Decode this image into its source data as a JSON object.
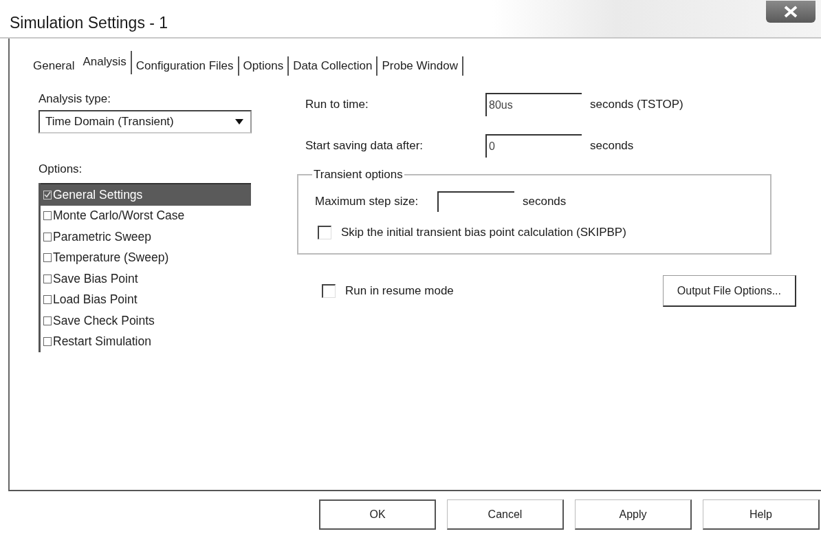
{
  "window": {
    "title": "Simulation Settings - 1"
  },
  "tabs": [
    {
      "label": "General",
      "selected": false
    },
    {
      "label": "Analysis",
      "selected": true
    },
    {
      "label": "Configuration Files",
      "selected": false
    },
    {
      "label": "Options",
      "selected": false
    },
    {
      "label": "Data Collection",
      "selected": false
    },
    {
      "label": "Probe Window",
      "selected": false
    }
  ],
  "analysis_type": {
    "label": "Analysis type:",
    "value": "Time Domain (Transient)"
  },
  "options": {
    "label": "Options:",
    "items": [
      {
        "label": "General Settings",
        "checked": true,
        "selected": true
      },
      {
        "label": "Monte Carlo/Worst Case",
        "checked": false,
        "selected": false
      },
      {
        "label": "Parametric Sweep",
        "checked": false,
        "selected": false
      },
      {
        "label": "Temperature (Sweep)",
        "checked": false,
        "selected": false
      },
      {
        "label": "Save Bias Point",
        "checked": false,
        "selected": false
      },
      {
        "label": "Load Bias Point",
        "checked": false,
        "selected": false
      },
      {
        "label": "Save Check Points",
        "checked": false,
        "selected": false
      },
      {
        "label": "Restart Simulation",
        "checked": false,
        "selected": false
      }
    ]
  },
  "run_to_time": {
    "label": "Run to time:",
    "value": "80us",
    "unit": "seconds  (TSTOP)"
  },
  "start_saving": {
    "label": "Start saving data after:",
    "value": "0",
    "unit": "seconds"
  },
  "transient_options": {
    "title": "Transient options",
    "max_step": {
      "label": "Maximum step size:",
      "unit": "seconds"
    },
    "skip_bias": {
      "label": "Skip the initial transient bias point calculation  (SKIPBP)",
      "checked": false
    }
  },
  "resume_mode": {
    "label": "Run in resume mode",
    "checked": false
  },
  "output_file_button": "Output File Options...",
  "buttons": [
    "OK",
    "Cancel",
    "Apply",
    "Help"
  ]
}
